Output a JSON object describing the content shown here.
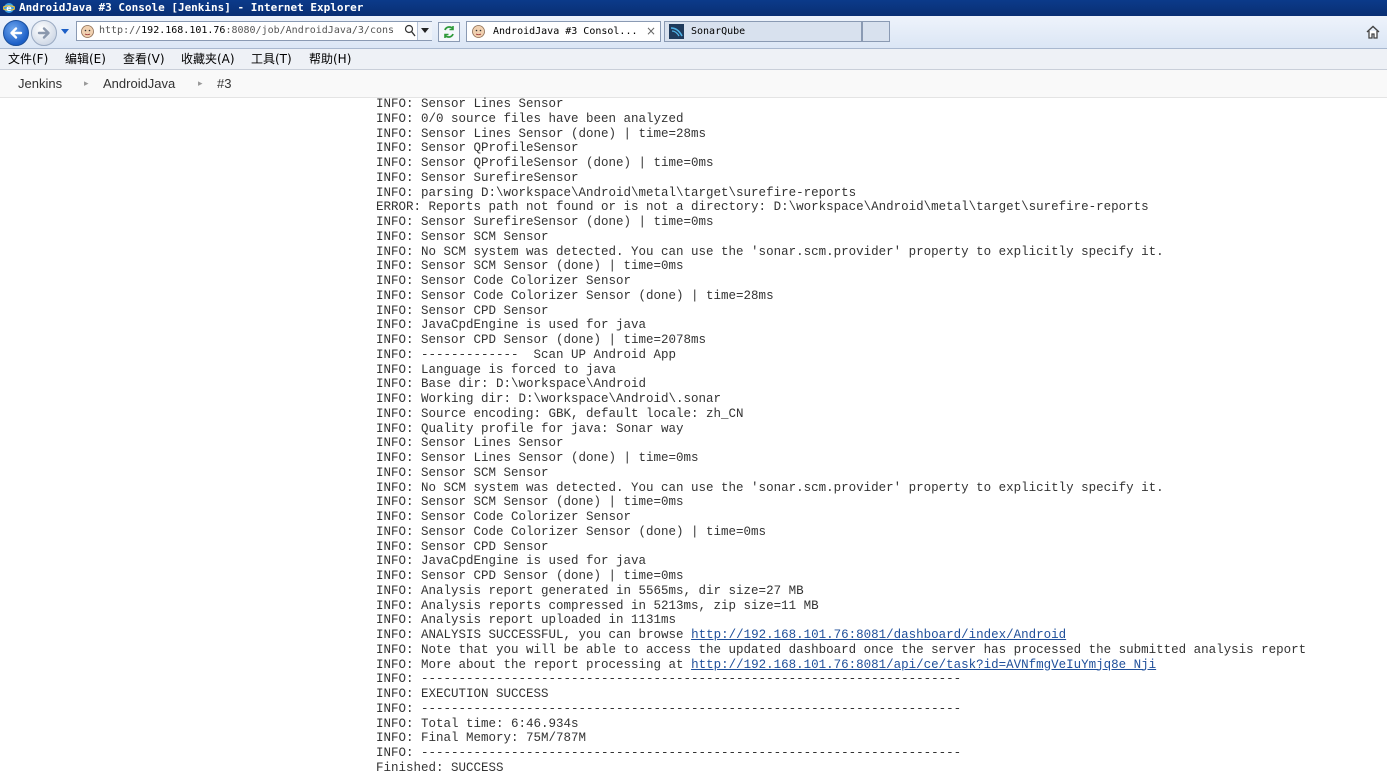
{
  "window": {
    "title": "AndroidJava #3 Console [Jenkins] - Internet Explorer"
  },
  "address_bar": {
    "url_prefix": "http://",
    "url_host": "192.168.101.76",
    "url_rest": ":8080/job/AndroidJava/3/cons"
  },
  "tabs": [
    {
      "label": "AndroidJava #3 Consol...",
      "close": "×"
    },
    {
      "label": "SonarQube"
    }
  ],
  "menu": [
    "文件(F)",
    "编辑(E)",
    "查看(V)",
    "收藏夹(A)",
    "工具(T)",
    "帮助(H)"
  ],
  "breadcrumbs": [
    "Jenkins",
    "AndroidJava",
    "#3"
  ],
  "console": [
    "INFO: Sensor Lines Sensor",
    "INFO: 0/0 source files have been analyzed",
    "INFO: Sensor Lines Sensor (done) | time=28ms",
    "INFO: Sensor QProfileSensor",
    "INFO: Sensor QProfileSensor (done) | time=0ms",
    "INFO: Sensor SurefireSensor",
    "INFO: parsing D:\\workspace\\Android\\metal\\target\\surefire-reports",
    "ERROR: Reports path not found or is not a directory: D:\\workspace\\Android\\metal\\target\\surefire-reports",
    "INFO: Sensor SurefireSensor (done) | time=0ms",
    "INFO: Sensor SCM Sensor",
    "INFO: No SCM system was detected. You can use the 'sonar.scm.provider' property to explicitly specify it.",
    "INFO: Sensor SCM Sensor (done) | time=0ms",
    "INFO: Sensor Code Colorizer Sensor",
    "INFO: Sensor Code Colorizer Sensor (done) | time=28ms",
    "INFO: Sensor CPD Sensor",
    "INFO: JavaCpdEngine is used for java",
    "INFO: Sensor CPD Sensor (done) | time=2078ms",
    "INFO: -------------  Scan UP Android App",
    "INFO: Language is forced to java",
    "INFO: Base dir: D:\\workspace\\Android",
    "INFO: Working dir: D:\\workspace\\Android\\.sonar",
    "INFO: Source encoding: GBK, default locale: zh_CN",
    "INFO: Quality profile for java: Sonar way",
    "INFO: Sensor Lines Sensor",
    "INFO: Sensor Lines Sensor (done) | time=0ms",
    "INFO: Sensor SCM Sensor",
    "INFO: No SCM system was detected. You can use the 'sonar.scm.provider' property to explicitly specify it.",
    "INFO: Sensor SCM Sensor (done) | time=0ms",
    "INFO: Sensor Code Colorizer Sensor",
    "INFO: Sensor Code Colorizer Sensor (done) | time=0ms",
    "INFO: Sensor CPD Sensor",
    "INFO: JavaCpdEngine is used for java",
    "INFO: Sensor CPD Sensor (done) | time=0ms",
    "INFO: Analysis report generated in 5565ms, dir size=27 MB",
    "INFO: Analysis reports compressed in 5213ms, zip size=11 MB",
    "INFO: Analysis report uploaded in 1131ms",
    "INFO: ANALYSIS SUCCESSFUL, you can browse ",
    "INFO: Note that you will be able to access the updated dashboard once the server has processed the submitted analysis report",
    "INFO: More about the report processing at ",
    "INFO: ------------------------------------------------------------------------",
    "INFO: EXECUTION SUCCESS",
    "INFO: ------------------------------------------------------------------------",
    "INFO: Total time: 6:46.934s",
    "INFO: Final Memory: 75M/787M",
    "INFO: ------------------------------------------------------------------------",
    "Finished: SUCCESS"
  ],
  "links": {
    "dashboard": "http://192.168.101.76:8081/dashboard/index/Android",
    "ce_task": "http://192.168.101.76:8081/api/ce/task?id=AVNfmgVeIuYmjq8e_Nji"
  },
  "colors": {
    "titlebar": "#0b3a8a",
    "link": "#1f4f9a",
    "console_text": "#333333"
  }
}
